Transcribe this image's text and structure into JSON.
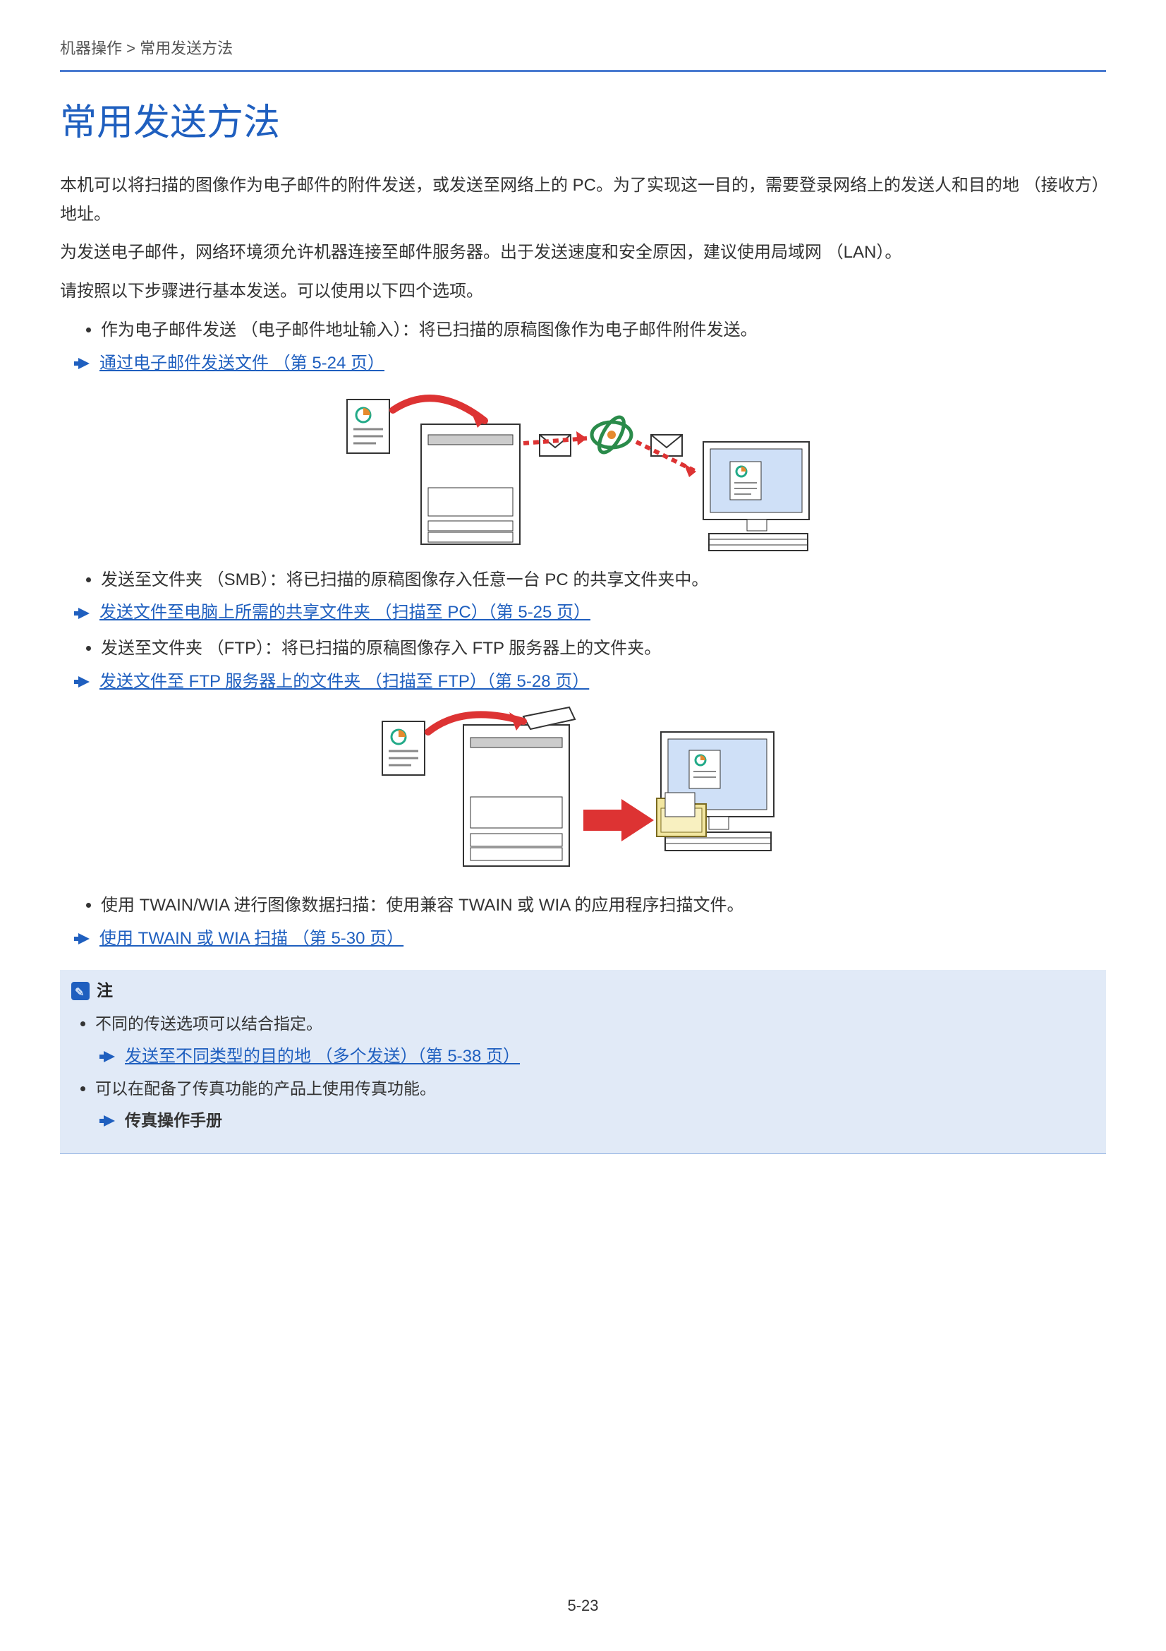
{
  "breadcrumb": "机器操作 > 常用发送方法",
  "title": "常用发送方法",
  "para1": "本机可以将扫描的图像作为电子邮件的附件发送，或发送至网络上的 PC。为了实现这一目的，需要登录网络上的发送人和目的地 （接收方）地址。",
  "para2": "为发送电子邮件，网络环境须允许机器连接至邮件服务器。出于发送速度和安全原因，建议使用局域网 （LAN）。",
  "para3": "请按照以下步骤进行基本发送。可以使用以下四个选项。",
  "bullets1": [
    "作为电子邮件发送 （电子邮件地址输入）：将已扫描的原稿图像作为电子邮件附件发送。"
  ],
  "link1": "通过电子邮件发送文件 （第 5-24 页）",
  "bullets2": [
    "发送至文件夹 （SMB）：将已扫描的原稿图像存入任意一台 PC 的共享文件夹中。"
  ],
  "link2": "发送文件至电脑上所需的共享文件夹 （扫描至 PC）（第 5-25 页）",
  "bullets3": [
    "发送至文件夹 （FTP）：将已扫描的原稿图像存入 FTP 服务器上的文件夹。"
  ],
  "link3": "发送文件至 FTP 服务器上的文件夹 （扫描至 FTP）（第 5-28 页）",
  "bullets4": [
    "使用 TWAIN/WIA 进行图像数据扫描：使用兼容 TWAIN 或 WIA 的应用程序扫描文件。"
  ],
  "link4": "使用 TWAIN 或 WIA 扫描 （第 5-30 页）",
  "note_label": "注",
  "note_item1": "不同的传送选项可以结合指定。",
  "note_link": "发送至不同类型的目的地 （多个发送）（第 5-38 页）",
  "note_item2": "可以在配备了传真功能的产品上使用传真功能。",
  "note_bold": "传真操作手册",
  "page_number": "5-23"
}
